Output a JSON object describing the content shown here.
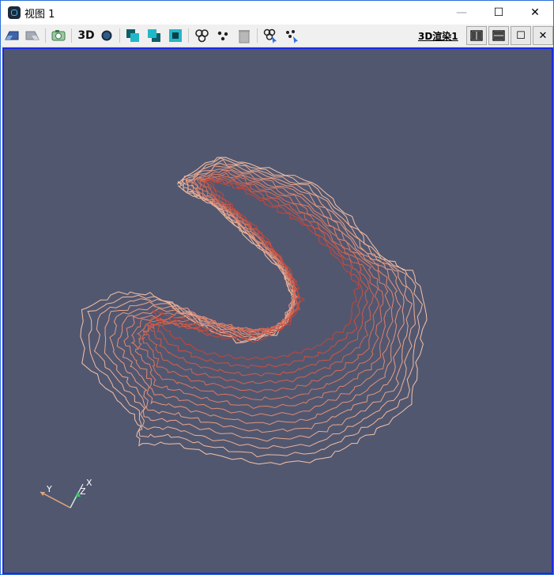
{
  "window": {
    "title": "视图 1",
    "controls": {
      "minimize": "—",
      "maximize": "☐",
      "close": "✕"
    }
  },
  "toolbar": {
    "mode_3d_label": "3D",
    "render_view_label": "3D渲染1",
    "buttons": [
      "camera-undo-icon",
      "camera-redo-icon",
      "screenshot-icon",
      "3d-toggle",
      "render-sphere-icon",
      "split-vertical-icon",
      "split-horizontal-icon",
      "maximize-view-icon",
      "select-cells-icon",
      "select-points-icon",
      "delete-selection-icon",
      "interactive-select-cells-icon",
      "interactive-select-points-icon"
    ],
    "view_controls": {
      "split_horizontal": "⫴",
      "split_vertical": "☰",
      "maximize": "☐",
      "close": "✕"
    }
  },
  "viewport": {
    "background": "#525770",
    "contour_colors": [
      "#f5c4a8",
      "#c84535"
    ]
  },
  "orientation_axes": {
    "x_label": "X",
    "y_label": "Y",
    "z_label": "Z"
  }
}
